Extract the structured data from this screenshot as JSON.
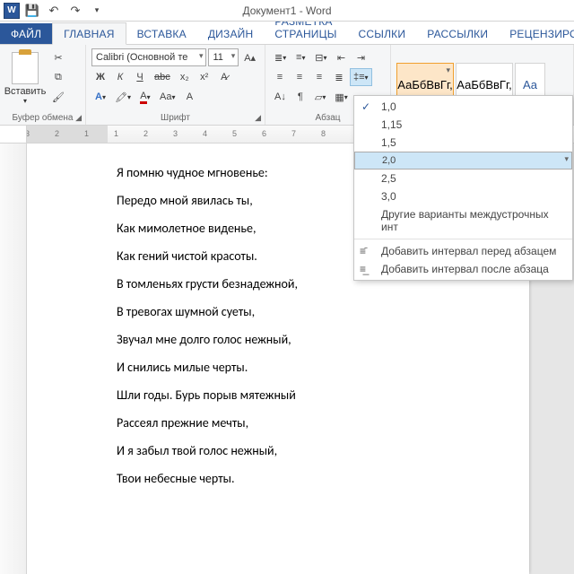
{
  "titlebar": {
    "title": "Документ1 - Word"
  },
  "tabs": {
    "file": "ФАЙЛ",
    "home": "ГЛАВНАЯ",
    "insert": "ВСТАВКА",
    "design": "ДИЗАЙН",
    "layout": "РАЗМЕТКА СТРАНИЦЫ",
    "references": "ССЫЛКИ",
    "mailings": "РАССЫЛКИ",
    "review": "РЕЦЕНЗИРОВ"
  },
  "ribbon": {
    "clipboard": {
      "label": "Буфер обмена",
      "paste": "Вставить"
    },
    "font": {
      "label": "Шрифт",
      "name": "Calibri (Основной те",
      "size": "11"
    },
    "paragraph": {
      "label": "Абзац"
    },
    "styles": {
      "sample": "АаБбВвГг,",
      "heading_prefix": "Аа"
    }
  },
  "ruler": {
    "marks": [
      "3",
      "2",
      "1",
      "1",
      "2",
      "3",
      "4",
      "5",
      "6",
      "7",
      "8"
    ]
  },
  "line_spacing_menu": {
    "items": [
      "1,0",
      "1,15",
      "1,5",
      "2,0",
      "2,5",
      "3,0"
    ],
    "checked_index": 0,
    "highlighted_index": 3,
    "more": "Другие варианты междустрочных инт",
    "add_before": "Добавить интервал перед абзацем",
    "add_after": "Добавить интервал после абзаца"
  },
  "document": {
    "lines": [
      "Я помню чудное мгновенье:",
      "Передо мной явилась ты,",
      "Как мимолетное виденье,",
      "Как гений чистой красоты.",
      "В томленьях грусти безнадежной,",
      "В тревогах шумной суеты,",
      "Звучал мне долго голос нежный,",
      "И снились милые черты.",
      "Шли годы. Бурь порыв мятежный",
      "Рассеял прежние мечты,",
      "И я забыл твой голос нежный,",
      "Твои небесные черты."
    ]
  }
}
